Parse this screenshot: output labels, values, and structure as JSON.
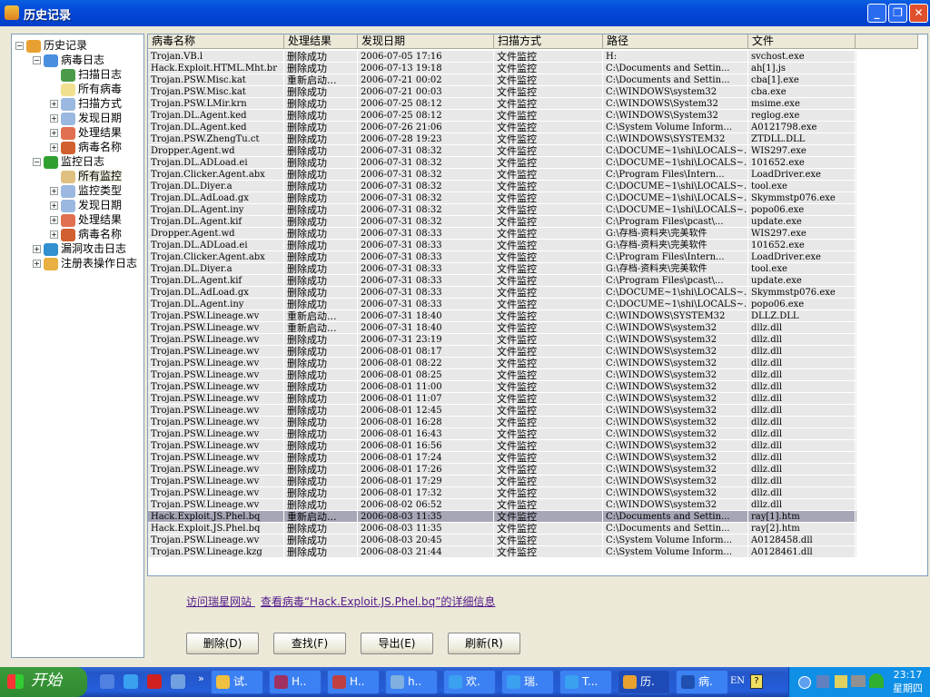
{
  "window": {
    "title": "历史记录",
    "minimize": "_",
    "restore": "❐",
    "close": "✕"
  },
  "tree": [
    {
      "label": "历史记录",
      "level": 0,
      "ex": "−",
      "icon": "books-icon",
      "color": "#e8a030"
    },
    {
      "label": "病毒日志",
      "level": 1,
      "ex": "−",
      "icon": "virus-log-icon",
      "color": "#4a8ee0"
    },
    {
      "label": "扫描日志",
      "level": 2,
      "ex": "",
      "icon": "scan-log-icon",
      "color": "#4a9a4a"
    },
    {
      "label": "所有病毒",
      "level": 2,
      "ex": "",
      "icon": "all-virus-icon",
      "color": "#f0e090"
    },
    {
      "label": "扫描方式",
      "level": 2,
      "ex": "+",
      "icon": "magnifier-icon",
      "color": "#9ab8e0"
    },
    {
      "label": "发现日期",
      "level": 2,
      "ex": "+",
      "icon": "clock-icon",
      "color": "#9ab8e0"
    },
    {
      "label": "处理结果",
      "level": 2,
      "ex": "+",
      "icon": "result-icon",
      "color": "#e07050"
    },
    {
      "label": "病毒名称",
      "level": 2,
      "ex": "+",
      "icon": "bug-icon",
      "color": "#d06030"
    },
    {
      "label": "监控日志",
      "level": 1,
      "ex": "−",
      "icon": "umbrella-icon",
      "color": "#30a030"
    },
    {
      "label": "所有监控",
      "level": 2,
      "ex": "",
      "icon": "all-monitor-icon",
      "color": "#e0c080",
      "selected": true
    },
    {
      "label": "监控类型",
      "level": 2,
      "ex": "+",
      "icon": "magnifier-icon",
      "color": "#9ab8e0"
    },
    {
      "label": "发现日期",
      "level": 2,
      "ex": "+",
      "icon": "clock-icon",
      "color": "#9ab8e0"
    },
    {
      "label": "处理结果",
      "level": 2,
      "ex": "+",
      "icon": "result-icon",
      "color": "#e07050"
    },
    {
      "label": "病毒名称",
      "level": 2,
      "ex": "+",
      "icon": "bug-icon",
      "color": "#d06030"
    },
    {
      "label": "漏洞攻击日志",
      "level": 1,
      "ex": "+",
      "icon": "shield-check-icon",
      "color": "#3090d0"
    },
    {
      "label": "注册表操作日志",
      "level": 1,
      "ex": "+",
      "icon": "registry-icon",
      "color": "#e8b040"
    }
  ],
  "table": {
    "columns": [
      "病毒名称",
      "处理结果",
      "发现日期",
      "扫描方式",
      "路径",
      "文件"
    ],
    "selected_index": 39,
    "rows": [
      [
        "Trojan.VB.l",
        "删除成功",
        "2006-07-05 17:16",
        "文件监控",
        "H:",
        "svchost.exe"
      ],
      [
        "Hack.Exploit.HTML.Mht.br",
        "删除成功",
        "2006-07-13 19:18",
        "文件监控",
        "C:\\Documents and Settin...",
        "ah[1].js"
      ],
      [
        "Trojan.PSW.Misc.kat",
        "重新启动...",
        "2006-07-21 00:02",
        "文件监控",
        "C:\\Documents and Settin...",
        "cba[1].exe"
      ],
      [
        "Trojan.PSW.Misc.kat",
        "删除成功",
        "2006-07-21 00:03",
        "文件监控",
        "C:\\WINDOWS\\system32",
        "cba.exe"
      ],
      [
        "Trojan.PSW.LMir.krn",
        "删除成功",
        "2006-07-25 08:12",
        "文件监控",
        "C:\\WINDOWS\\System32",
        "msime.exe"
      ],
      [
        "Trojan.DL.Agent.ked",
        "删除成功",
        "2006-07-25 08:12",
        "文件监控",
        "C:\\WINDOWS\\System32",
        "reglog.exe"
      ],
      [
        "Trojan.DL.Agent.ked",
        "删除成功",
        "2006-07-26 21:06",
        "文件监控",
        "C:\\System Volume Inform...",
        "A0121798.exe"
      ],
      [
        "Trojan.PSW.ZhengTu.ct",
        "删除成功",
        "2006-07-28 19:23",
        "文件监控",
        "C:\\WINDOWS\\SYSTEM32",
        "ZTDLL.DLL"
      ],
      [
        "Dropper.Agent.wd",
        "删除成功",
        "2006-07-31 08:32",
        "文件监控",
        "C:\\DOCUME~1\\shi\\LOCALS~...",
        "WIS297.exe"
      ],
      [
        "Trojan.DL.ADLoad.ei",
        "删除成功",
        "2006-07-31 08:32",
        "文件监控",
        "C:\\DOCUME~1\\shi\\LOCALS~...",
        "101652.exe"
      ],
      [
        "Trojan.Clicker.Agent.abx",
        "删除成功",
        "2006-07-31 08:32",
        "文件监控",
        "C:\\Program Files\\Intern...",
        "LoadDriver.exe"
      ],
      [
        "Trojan.DL.Diyer.a",
        "删除成功",
        "2006-07-31 08:32",
        "文件监控",
        "C:\\DOCUME~1\\shi\\LOCALS~...",
        "tool.exe"
      ],
      [
        "Trojan.DL.AdLoad.gx",
        "删除成功",
        "2006-07-31 08:32",
        "文件监控",
        "C:\\DOCUME~1\\shi\\LOCALS~...",
        "Skymmstp076.exe"
      ],
      [
        "Trojan.DL.Agent.iny",
        "删除成功",
        "2006-07-31 08:32",
        "文件监控",
        "C:\\DOCUME~1\\shi\\LOCALS~...",
        "popo06.exe"
      ],
      [
        "Trojan.DL.Agent.kif",
        "删除成功",
        "2006-07-31 08:32",
        "文件监控",
        "C:\\Program Files\\pcast\\...",
        "update.exe"
      ],
      [
        "Dropper.Agent.wd",
        "删除成功",
        "2006-07-31 08:33",
        "文件监控",
        "G:\\存档-资料夹\\完美软件",
        "WIS297.exe"
      ],
      [
        "Trojan.DL.ADLoad.ei",
        "删除成功",
        "2006-07-31 08:33",
        "文件监控",
        "G:\\存档-资料夹\\完美软件",
        "101652.exe"
      ],
      [
        "Trojan.Clicker.Agent.abx",
        "删除成功",
        "2006-07-31 08:33",
        "文件监控",
        "C:\\Program Files\\Intern...",
        "LoadDriver.exe"
      ],
      [
        "Trojan.DL.Diyer.a",
        "删除成功",
        "2006-07-31 08:33",
        "文件监控",
        "G:\\存档-资料夹\\完美软件",
        "tool.exe"
      ],
      [
        "Trojan.DL.Agent.kif",
        "删除成功",
        "2006-07-31 08:33",
        "文件监控",
        "C:\\Program Files\\pcast\\...",
        "update.exe"
      ],
      [
        "Trojan.DL.AdLoad.gx",
        "删除成功",
        "2006-07-31 08:33",
        "文件监控",
        "C:\\DOCUME~1\\shi\\LOCALS~...",
        "Skymmstp076.exe"
      ],
      [
        "Trojan.DL.Agent.iny",
        "删除成功",
        "2006-07-31 08:33",
        "文件监控",
        "C:\\DOCUME~1\\shi\\LOCALS~...",
        "popo06.exe"
      ],
      [
        "Trojan.PSW.Lineage.wv",
        "重新启动...",
        "2006-07-31 18:40",
        "文件监控",
        "C:\\WINDOWS\\SYSTEM32",
        "DLLZ.DLL"
      ],
      [
        "Trojan.PSW.Lineage.wv",
        "重新启动...",
        "2006-07-31 18:40",
        "文件监控",
        "C:\\WINDOWS\\system32",
        "dllz.dll"
      ],
      [
        "Trojan.PSW.Lineage.wv",
        "删除成功",
        "2006-07-31 23:19",
        "文件监控",
        "C:\\WINDOWS\\system32",
        "dllz.dll"
      ],
      [
        "Trojan.PSW.Lineage.wv",
        "删除成功",
        "2006-08-01 08:17",
        "文件监控",
        "C:\\WINDOWS\\system32",
        "dllz.dll"
      ],
      [
        "Trojan.PSW.Lineage.wv",
        "删除成功",
        "2006-08-01 08:22",
        "文件监控",
        "C:\\WINDOWS\\system32",
        "dllz.dll"
      ],
      [
        "Trojan.PSW.Lineage.wv",
        "删除成功",
        "2006-08-01 08:25",
        "文件监控",
        "C:\\WINDOWS\\system32",
        "dllz.dll"
      ],
      [
        "Trojan.PSW.Lineage.wv",
        "删除成功",
        "2006-08-01 11:00",
        "文件监控",
        "C:\\WINDOWS\\system32",
        "dllz.dll"
      ],
      [
        "Trojan.PSW.Lineage.wv",
        "删除成功",
        "2006-08-01 11:07",
        "文件监控",
        "C:\\WINDOWS\\system32",
        "dllz.dll"
      ],
      [
        "Trojan.PSW.Lineage.wv",
        "删除成功",
        "2006-08-01 12:45",
        "文件监控",
        "C:\\WINDOWS\\system32",
        "dllz.dll"
      ],
      [
        "Trojan.PSW.Lineage.wv",
        "删除成功",
        "2006-08-01 16:28",
        "文件监控",
        "C:\\WINDOWS\\system32",
        "dllz.dll"
      ],
      [
        "Trojan.PSW.Lineage.wv",
        "删除成功",
        "2006-08-01 16:43",
        "文件监控",
        "C:\\WINDOWS\\system32",
        "dllz.dll"
      ],
      [
        "Trojan.PSW.Lineage.wv",
        "删除成功",
        "2006-08-01 16:56",
        "文件监控",
        "C:\\WINDOWS\\system32",
        "dllz.dll"
      ],
      [
        "Trojan.PSW.Lineage.wv",
        "删除成功",
        "2006-08-01 17:24",
        "文件监控",
        "C:\\WINDOWS\\system32",
        "dllz.dll"
      ],
      [
        "Trojan.PSW.Lineage.wv",
        "删除成功",
        "2006-08-01 17:26",
        "文件监控",
        "C:\\WINDOWS\\system32",
        "dllz.dll"
      ],
      [
        "Trojan.PSW.Lineage.wv",
        "删除成功",
        "2006-08-01 17:29",
        "文件监控",
        "C:\\WINDOWS\\system32",
        "dllz.dll"
      ],
      [
        "Trojan.PSW.Lineage.wv",
        "删除成功",
        "2006-08-01 17:32",
        "文件监控",
        "C:\\WINDOWS\\system32",
        "dllz.dll"
      ],
      [
        "Trojan.PSW.Lineage.wv",
        "删除成功",
        "2006-08-02 06:52",
        "文件监控",
        "C:\\WINDOWS\\system32",
        "dllz.dll"
      ],
      [
        "Hack.Exploit.JS.Phel.bq",
        "重新启动...",
        "2006-08-03 11:35",
        "文件监控",
        "C:\\Documents and Settin...",
        "ray[1].htm"
      ],
      [
        "Hack.Exploit.JS.Phel.bq",
        "删除成功",
        "2006-08-03 11:35",
        "文件监控",
        "C:\\Documents and Settin...",
        "ray[2].htm"
      ],
      [
        "Trojan.PSW.Lineage.wv",
        "删除成功",
        "2006-08-03 20:45",
        "文件监控",
        "C:\\System Volume Inform...",
        "A0128458.dll"
      ],
      [
        "Trojan.PSW.Lineage.kzg",
        "删除成功",
        "2006-08-03 21:44",
        "文件监控",
        "C:\\System Volume Inform...",
        "A0128461.dll"
      ]
    ]
  },
  "links": {
    "visit": "访问瑞星网站",
    "detail": "查看病毒“Hack.Exploit.JS.Phel.bq”的详细信息"
  },
  "buttons": {
    "delete": "删除(D)",
    "find": "查找(F)",
    "export": "导出(E)",
    "refresh": "刷新(R)"
  },
  "taskbar": {
    "start": "开始",
    "quicklaunch": [
      {
        "icon": "desktop-icon",
        "color": "#5080e0"
      },
      {
        "icon": "ie-icon",
        "color": "#3aa0f0"
      },
      {
        "icon": "media-icon",
        "color": "#d02020"
      },
      {
        "icon": "outlook-icon",
        "color": "#70a0e0"
      }
    ],
    "chevron": "»",
    "items": [
      {
        "label": "试.",
        "icon": "folder-icon",
        "color": "#f0c040"
      },
      {
        "label": "H..",
        "icon": "winrar-icon",
        "color": "#a03060"
      },
      {
        "label": "H..",
        "icon": "app-icon",
        "color": "#c04040"
      },
      {
        "label": "h..",
        "icon": "document-icon",
        "color": "#80b0e0"
      },
      {
        "label": "欢.",
        "icon": "ie-icon",
        "color": "#3aa0f0"
      },
      {
        "label": "瑞.",
        "icon": "ie-icon",
        "color": "#3aa0f0"
      },
      {
        "label": "T...",
        "icon": "ie-icon",
        "color": "#3aa0f0"
      },
      {
        "label": "历.",
        "icon": "books-icon",
        "color": "#e8a030",
        "active": true
      },
      {
        "label": "病.",
        "icon": "rising-icon",
        "color": "#2050b0"
      }
    ],
    "lang": "EN",
    "time": "23:17",
    "day": "星期四"
  }
}
